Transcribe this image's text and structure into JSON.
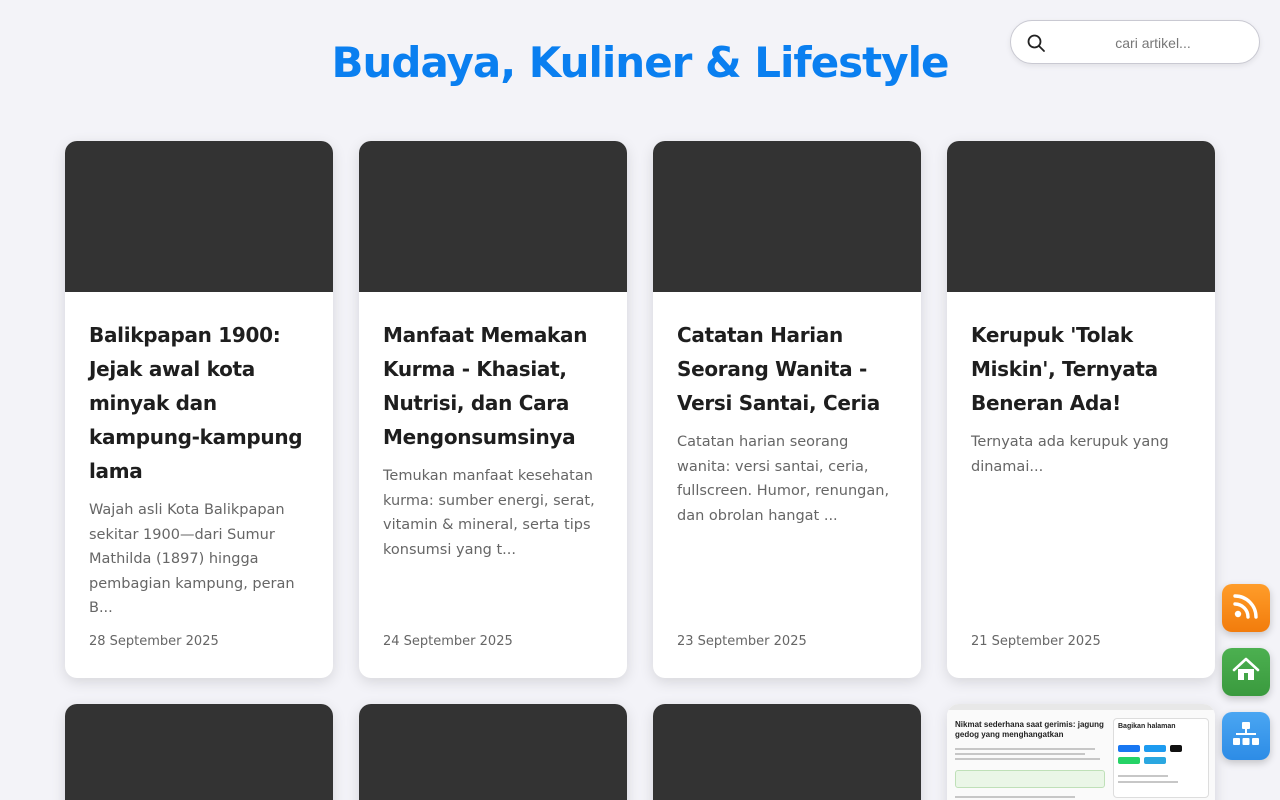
{
  "header": {
    "title": "Budaya, Kuliner & Lifestyle"
  },
  "search": {
    "placeholder": "cari artikel...",
    "icon": "search-icon"
  },
  "articles": [
    {
      "title": "Balikpapan 1900: Jejak awal kota minyak dan kampung-kampung lama",
      "excerpt": "Wajah asli Kota Balikpapan sekitar 1900—dari Sumur Mathilda (1897) hingga pembagian kampung, peran B...",
      "date": "28 September 2025"
    },
    {
      "title": "Manfaat Memakan Kurma - Khasiat, Nutrisi, dan Cara Mengonsumsinya",
      "excerpt": "Temukan manfaat kesehatan kurma: sumber energi, serat, vitamin & mineral, serta tips konsumsi yang t...",
      "date": "24 September 2025"
    },
    {
      "title": "Catatan Harian Seorang Wanita - Versi Santai, Ceria",
      "excerpt": "Catatan harian seorang wanita: versi santai, ceria, fullscreen. Humor, renungan, dan obrolan hangat ...",
      "date": "23 September 2025"
    },
    {
      "title": "Kerupuk 'Tolak Miskin', Ternyata Beneran Ada!",
      "excerpt": "Ternyata ada kerupuk yang dinamai...",
      "date": "21 September 2025"
    }
  ],
  "preview_card": {
    "heading": "Nikmat sederhana saat gerimis: jagung gedog yang menghangatkan",
    "sidebar_heading": "Bagikan halaman"
  },
  "floating_buttons": [
    {
      "name": "rss",
      "icon": "rss-icon",
      "color": "#f7891a"
    },
    {
      "name": "home",
      "icon": "home-icon",
      "color": "#43a547"
    },
    {
      "name": "sitemap",
      "icon": "sitemap-icon",
      "color": "#3a98ec"
    }
  ],
  "colors": {
    "accent": "#0a7ff0",
    "thumb_placeholder": "#333333",
    "background": "#f3f3f8"
  }
}
